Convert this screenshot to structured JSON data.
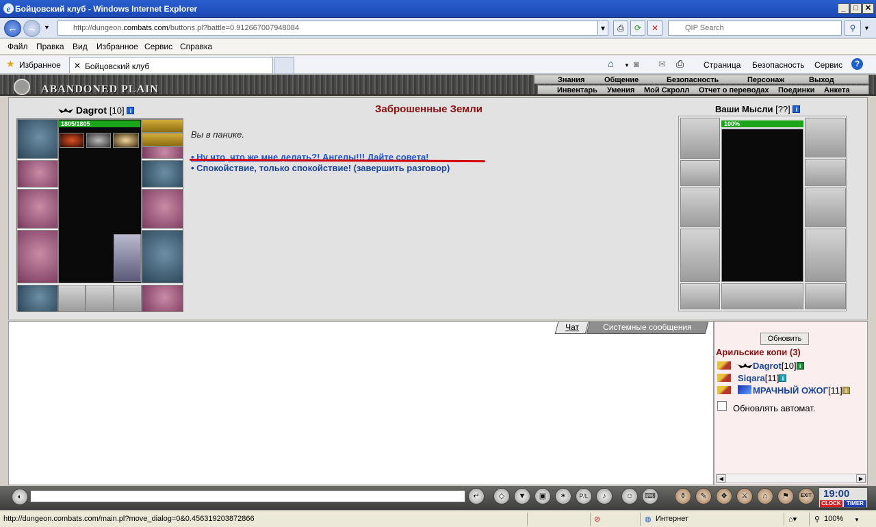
{
  "window": {
    "title": "Бойцовский клуб - Windows Internet Explorer"
  },
  "address": {
    "url_prefix": "http://dungeon.",
    "url_domain": "combats.com",
    "url_rest": "/buttons.pl?battle=0.912667007948084",
    "search_placeholder": "QIP Search"
  },
  "menu": [
    "Файл",
    "Правка",
    "Вид",
    "Избранное",
    "Сервис",
    "Справка"
  ],
  "favorites": {
    "label": "Избранное",
    "tab_title": "Бойцовский клуб"
  },
  "ie_commands": {
    "page": "Страница",
    "safety": "Безопасность",
    "tools": "Сервис"
  },
  "game": {
    "name": "ABANDONED PLAIN",
    "nav_top": [
      "Знания",
      "Общение",
      "Безопасность",
      "Персонаж",
      "Выход"
    ],
    "nav_bottom": [
      "Инвентарь",
      "Умения",
      "Мой Скролл",
      "Отчет о переводах",
      "Поединки",
      "Анкета"
    ]
  },
  "character": {
    "name": "Dagrot",
    "level": "[10]",
    "hp": "1805/1805"
  },
  "location": {
    "title": "Заброшенные Земли"
  },
  "dialog": {
    "text": "Вы в панике.",
    "options": [
      "• Ну что, что же мне делать?! Ангелы!!! Дайте совета!",
      "• Спокойствие, только спокойствие! (завершить разговор)"
    ]
  },
  "thoughts": {
    "title": "Ваши Мысли",
    "level": "[??]",
    "bar": "100%"
  },
  "chat": {
    "tabs": [
      "Чат",
      "Системные сообщения"
    ]
  },
  "room": {
    "refresh_label": "Обновить",
    "title": "Арильские копи (3)",
    "players": [
      {
        "name": "Dagrot",
        "level": "[10]"
      },
      {
        "name": "Siqara",
        "level": "[11]"
      },
      {
        "name": "МРАЧНЫЙ ОЖОГ",
        "level": "[11]"
      }
    ],
    "auto_refresh_label": "Обновлять автомат."
  },
  "clock": {
    "time": "19:00",
    "clock_label": "CLOCK",
    "timer_label": "TIMER",
    "exit_label": "EXIT"
  },
  "status": {
    "url": "http://dungeon.combats.com/main.pl?move_dialog=0&0.456319203872866",
    "zone": "Интернет",
    "zoom": "100%"
  },
  "icons": [
    "back-icon",
    "forward-icon",
    "refresh-icon",
    "stop-icon",
    "search-icon",
    "home-icon",
    "rss-icon",
    "mail-icon",
    "print-icon",
    "help-icon",
    "star-icon"
  ],
  "colors": {
    "titlebar": "#2a5fce",
    "location_title": "#8b0f0f",
    "link": "#1d56d8",
    "hp": "#1aa51a",
    "underline": "#d60000"
  }
}
